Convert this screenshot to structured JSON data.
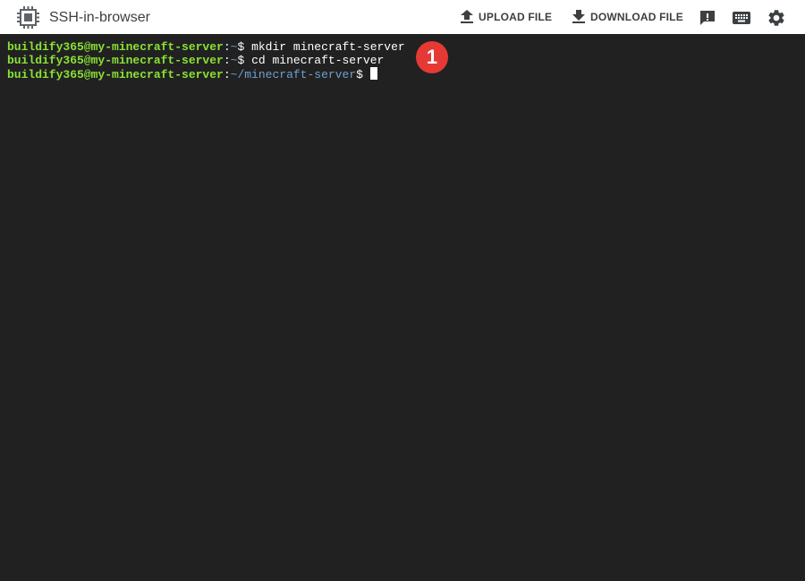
{
  "app": {
    "title": "SSH-in-browser",
    "icon": "chip-icon"
  },
  "toolbar": {
    "upload_label": "UPLOAD FILE",
    "download_label": "DOWNLOAD FILE",
    "feedback_icon": "feedback-icon",
    "keyboard_icon": "keyboard-icon",
    "settings_icon": "gear-icon"
  },
  "terminal": {
    "lines": [
      {
        "user": "buildify365@my-minecraft-server",
        "colon": ":",
        "path": "~",
        "dollar": "$",
        "command": " mkdir minecraft-server"
      },
      {
        "user": "buildify365@my-minecraft-server",
        "colon": ":",
        "path": "~",
        "dollar": "$",
        "command": " cd minecraft-server"
      },
      {
        "user": "buildify365@my-minecraft-server",
        "colon": ":",
        "path": "~/minecraft-server",
        "dollar": "$",
        "command": ""
      }
    ]
  },
  "annotation": {
    "step": "1"
  },
  "colors": {
    "terminal_bg": "#212121",
    "prompt_user": "#8ae234",
    "prompt_path": "#729fcf",
    "badge": "#e53935"
  }
}
